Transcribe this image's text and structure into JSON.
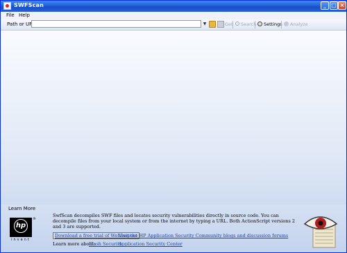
{
  "window": {
    "title": "SWFScan"
  },
  "menu": {
    "file": "File",
    "help": "Help"
  },
  "toolbar": {
    "path_label": "Path or URL:",
    "path_value": "",
    "get_label": "Get",
    "search_label": "Search",
    "settings_label": "Settings",
    "analyze_label": "Analyze"
  },
  "learn_more": {
    "title": "Learn More",
    "hp_tagline": "invent",
    "description": "SwfScan decompiles SWF files and locates security vulnerabilities directly in source code.  You can decompile files from your local system or from the internet by typing a URL.  Both ActionScript versions 2 and 3 are supported.",
    "trial_link": "Download a free trial of WebInspect",
    "community_link": "Visit the HP Application Security Community blogs and discussion forums",
    "learn_prefix": "Learn more about:",
    "flash_link": "Flash Security",
    "asc_link": "Application Security Center"
  },
  "colors": {
    "accent_blue": "#1f5fd6",
    "link_blue": "#1a3faa",
    "panel_blue": "#c3d3ee"
  }
}
